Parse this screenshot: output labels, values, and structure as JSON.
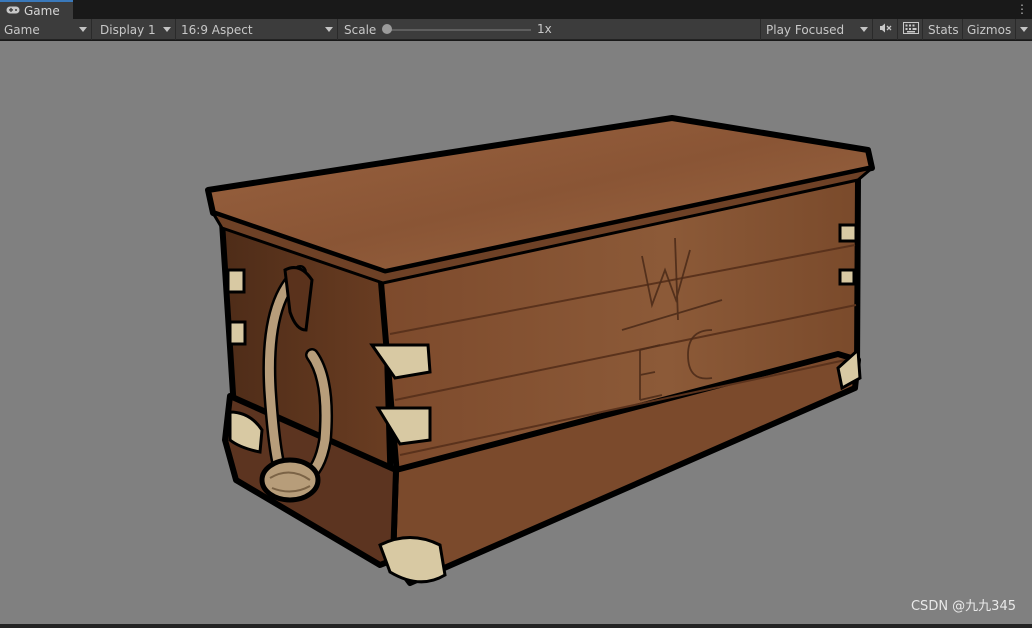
{
  "tab": {
    "label": "Game",
    "icon": "gamepad-icon",
    "menu_icon": "kebab-menu-icon"
  },
  "toolbar": {
    "view_mode": "Game",
    "display": "Display 1",
    "aspect": "16:9 Aspect",
    "scale_label": "Scale",
    "scale_value": "1x",
    "scale_fraction": 0.0,
    "play_mode": "Play Focused",
    "mute_icon": "audio-mute-icon",
    "stats_icon": "keyboard-shortcuts-icon",
    "stats_label": "Stats",
    "gizmos_label": "Gizmos"
  },
  "viewport": {
    "background": "#808080",
    "object": "wooden chest",
    "lid_monogram": {
      "top": "W",
      "left": "E",
      "right": "C"
    }
  },
  "watermark": "CSDN @九九345"
}
